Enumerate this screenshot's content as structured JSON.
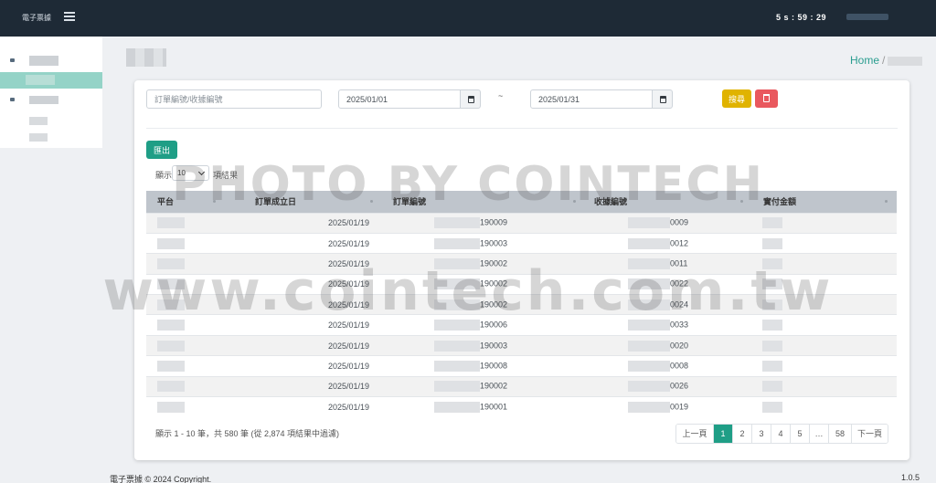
{
  "topbar": {
    "brand": "電子票據",
    "timer": "5 s : 59 : 29"
  },
  "breadcrumb": {
    "home": "Home",
    "separator": "/"
  },
  "filters": {
    "order_placeholder": "訂單編號/收據編號",
    "date_from": "2025/01/01",
    "date_to": "2025/01/31",
    "range_separator": "~",
    "search_label": "搜尋"
  },
  "toolbar": {
    "export_label": "匯出",
    "show_label": "顯示",
    "page_size": "10",
    "show_suffix": "項結果"
  },
  "table": {
    "headers": [
      "平台",
      "訂單成立日",
      "訂單編號",
      "收據編號",
      "實付金額"
    ],
    "rows": [
      {
        "date": "2025/01/19",
        "order": "190009",
        "receipt": "0009"
      },
      {
        "date": "2025/01/19",
        "order": "190003",
        "receipt": "0012"
      },
      {
        "date": "2025/01/19",
        "order": "190002",
        "receipt": "0011"
      },
      {
        "date": "2025/01/19",
        "order": "190002",
        "receipt": "0022"
      },
      {
        "date": "2025/01/19",
        "order": "190002",
        "receipt": "0024"
      },
      {
        "date": "2025/01/19",
        "order": "190006",
        "receipt": "0033"
      },
      {
        "date": "2025/01/19",
        "order": "190003",
        "receipt": "0020"
      },
      {
        "date": "2025/01/19",
        "order": "190008",
        "receipt": "0008"
      },
      {
        "date": "2025/01/19",
        "order": "190002",
        "receipt": "0026"
      },
      {
        "date": "2025/01/19",
        "order": "190001",
        "receipt": "0019"
      }
    ]
  },
  "table_info": "顯示 1 - 10 筆，共 580 筆 (從 2,874 項結果中過濾)",
  "pagination": {
    "prev": "上一頁",
    "pages": [
      "1",
      "2",
      "3",
      "4",
      "5",
      "…",
      "58"
    ],
    "next": "下一頁",
    "current": "1"
  },
  "footer": {
    "copyright": "電子票據 © 2024 Copyright.",
    "version": "1.0.5"
  },
  "watermark": {
    "line1": "PHOTO BY COINTECH",
    "line2": "www.cointech.com.tw"
  },
  "colors": {
    "topbar": "#1e2a36",
    "accent": "#1f9e86",
    "search": "#e0b300",
    "delete": "#e9585e",
    "sidebar_active": "#94d3c7"
  }
}
